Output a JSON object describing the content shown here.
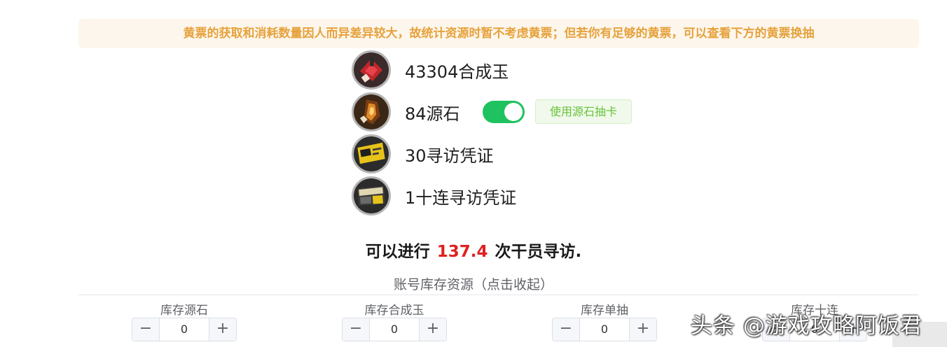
{
  "notice": "黄票的获取和消耗数量因人而异差异较大，故统计资源时暂不考虑黄票；但若你有足够的黄票，可以查看下方的黄票换抽",
  "resources": [
    {
      "label": "43304合成玉",
      "icon": "orundum-icon"
    },
    {
      "label": "84源石",
      "icon": "originite-icon"
    },
    {
      "label": "30寻访凭证",
      "icon": "headhunting-permit-icon"
    },
    {
      "label": "1十连寻访凭证",
      "icon": "ten-roll-permit-icon"
    }
  ],
  "originite_toggle": {
    "on": true
  },
  "originite_tag": "使用源石抽卡",
  "summary": {
    "prefix": "可以进行",
    "value": "137.4",
    "suffix": "次干员寻访."
  },
  "collapse_label": "账号库存资源（点击收起）",
  "stock": [
    {
      "label": "库存源石",
      "value": "0"
    },
    {
      "label": "库存合成玉",
      "value": "0"
    },
    {
      "label": "库存单抽",
      "value": "0"
    },
    {
      "label": "库存十连",
      "value": "0"
    }
  ],
  "stepper_minus": "−",
  "stepper_plus": "+",
  "watermark": "头条 @游戏攻略阿饭君",
  "colors": {
    "notice_bg": "#fdf6ec",
    "notice_text": "#e6a23c",
    "toggle_on": "#1ec25f",
    "highlight_number": "#e02020",
    "tag_text": "#67c23a"
  }
}
